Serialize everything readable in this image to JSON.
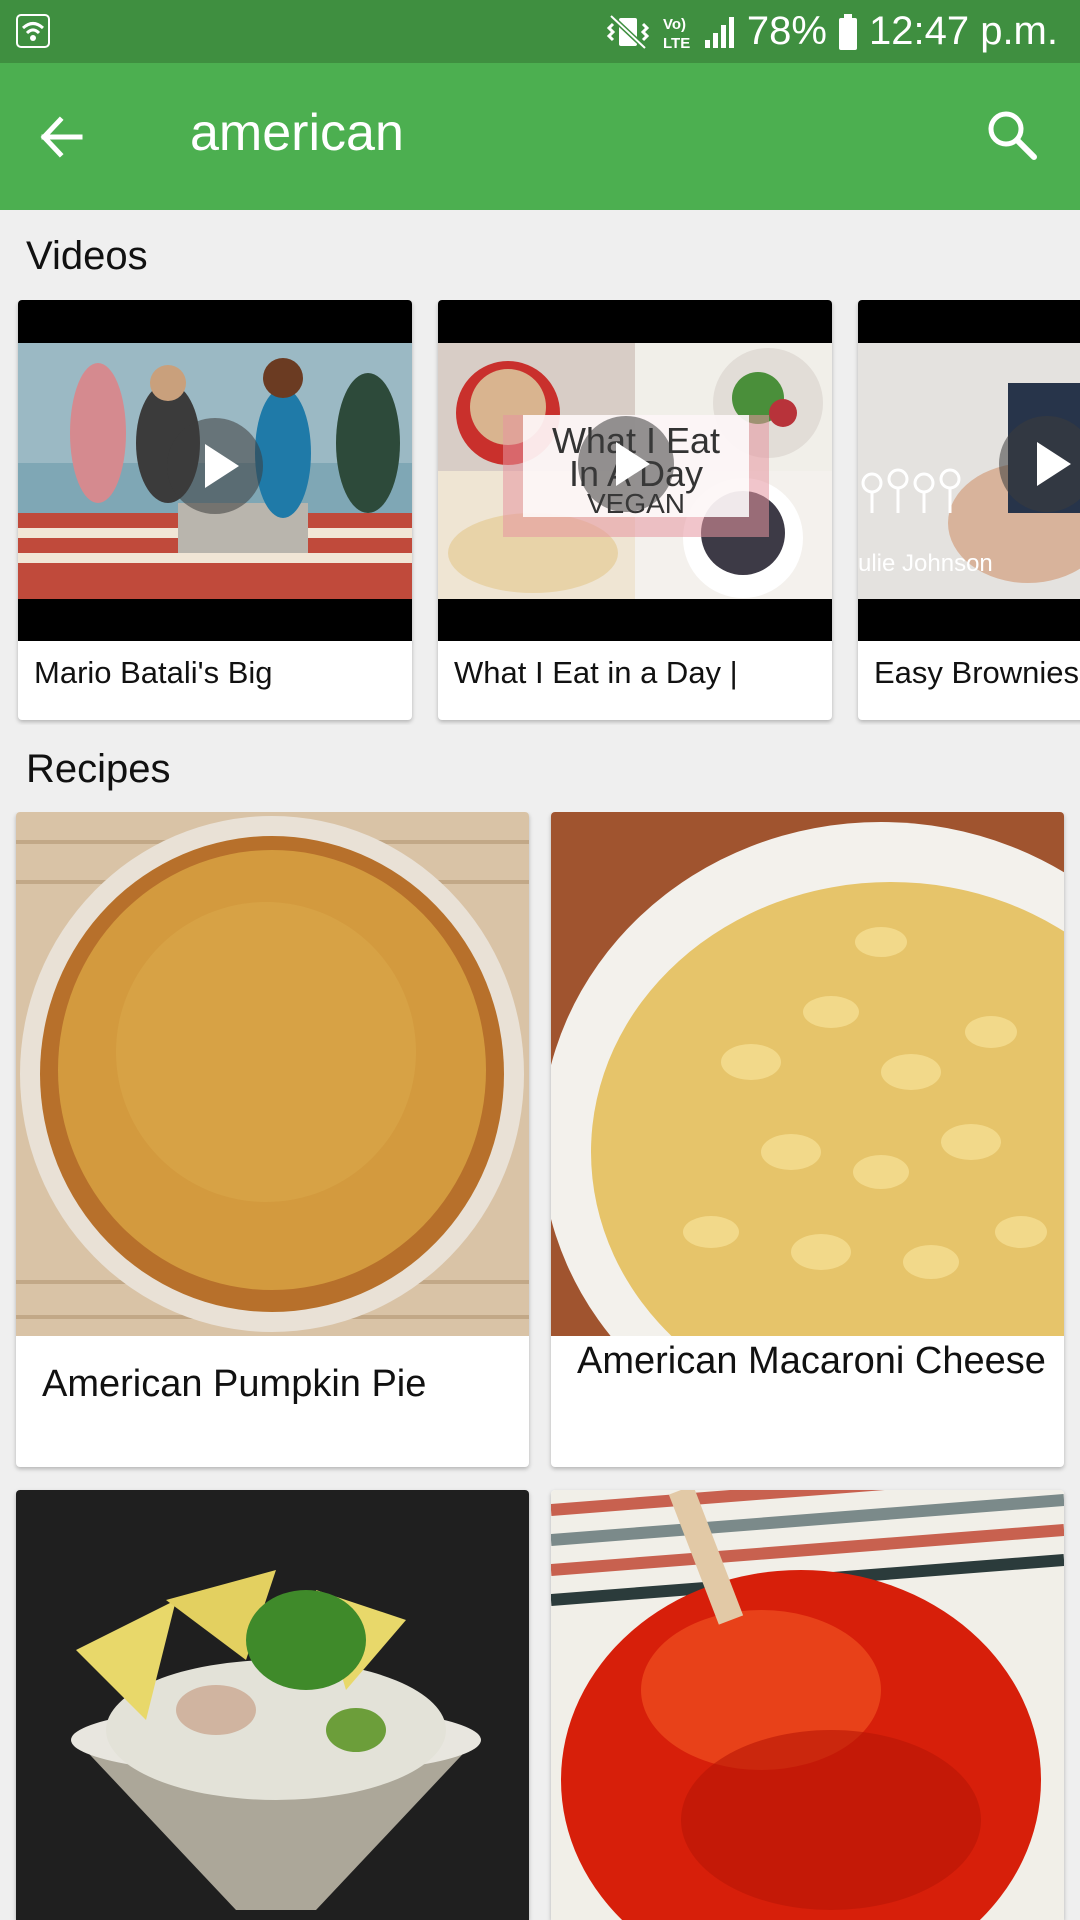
{
  "status_bar": {
    "battery": "78%",
    "time": "12:47 p.m.",
    "icons": [
      "wifi-icon",
      "vibrate-icon",
      "volte-icon",
      "signal-icon",
      "battery-icon"
    ]
  },
  "app_bar": {
    "title": "american",
    "back_icon": "arrow-back-icon",
    "search_icon": "search-icon"
  },
  "videos": {
    "heading": "Videos",
    "items": [
      {
        "title": "Mario Batali's Big"
      },
      {
        "title": "What I Eat in a Day |",
        "thumbnail_text": [
          "What I Eat",
          "In A Day",
          "VEGAN"
        ]
      },
      {
        "title": "Easy Brownies",
        "thumbnail_text": [
          "ulie Johnson"
        ]
      }
    ]
  },
  "recipes": {
    "heading": "Recipes",
    "items": [
      {
        "title": "American Pumpkin Pie"
      },
      {
        "title": "American Macaroni Cheese"
      },
      {
        "title": ""
      },
      {
        "title": ""
      }
    ]
  },
  "colors": {
    "status_bar": "#3f8f40",
    "app_bar": "#4caf50",
    "background": "#efefef"
  }
}
